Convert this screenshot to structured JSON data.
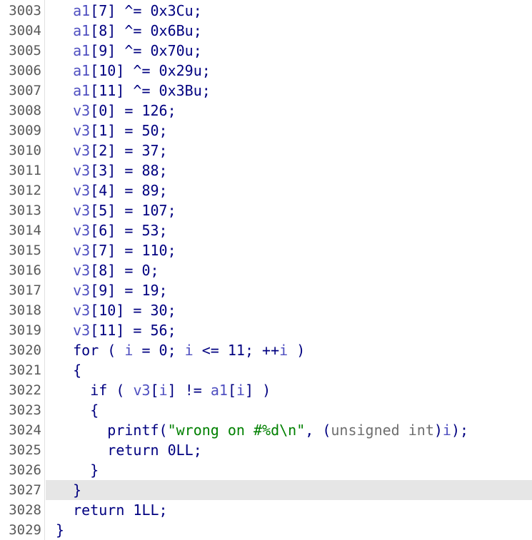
{
  "lines": [
    {
      "no": "3003",
      "indent": 1,
      "tokens": [
        {
          "t": "a1",
          "c": "v"
        },
        {
          "t": "[7] ^= 0x3Cu;",
          "c": "k"
        }
      ]
    },
    {
      "no": "3004",
      "indent": 1,
      "tokens": [
        {
          "t": "a1",
          "c": "v"
        },
        {
          "t": "[8] ^= 0x6Bu;",
          "c": "k"
        }
      ]
    },
    {
      "no": "3005",
      "indent": 1,
      "tokens": [
        {
          "t": "a1",
          "c": "v"
        },
        {
          "t": "[9] ^= 0x70u;",
          "c": "k"
        }
      ]
    },
    {
      "no": "3006",
      "indent": 1,
      "tokens": [
        {
          "t": "a1",
          "c": "v"
        },
        {
          "t": "[10] ^= 0x29u;",
          "c": "k"
        }
      ]
    },
    {
      "no": "3007",
      "indent": 1,
      "tokens": [
        {
          "t": "a1",
          "c": "v"
        },
        {
          "t": "[11] ^= 0x3Bu;",
          "c": "k"
        }
      ]
    },
    {
      "no": "3008",
      "indent": 1,
      "tokens": [
        {
          "t": "v3",
          "c": "v"
        },
        {
          "t": "[0] = 126;",
          "c": "k"
        }
      ]
    },
    {
      "no": "3009",
      "indent": 1,
      "tokens": [
        {
          "t": "v3",
          "c": "v"
        },
        {
          "t": "[1] = 50;",
          "c": "k"
        }
      ]
    },
    {
      "no": "3010",
      "indent": 1,
      "tokens": [
        {
          "t": "v3",
          "c": "v"
        },
        {
          "t": "[2] = 37;",
          "c": "k"
        }
      ]
    },
    {
      "no": "3011",
      "indent": 1,
      "tokens": [
        {
          "t": "v3",
          "c": "v"
        },
        {
          "t": "[3] = 88;",
          "c": "k"
        }
      ]
    },
    {
      "no": "3012",
      "indent": 1,
      "tokens": [
        {
          "t": "v3",
          "c": "v"
        },
        {
          "t": "[4] = 89;",
          "c": "k"
        }
      ]
    },
    {
      "no": "3013",
      "indent": 1,
      "tokens": [
        {
          "t": "v3",
          "c": "v"
        },
        {
          "t": "[5] = 107;",
          "c": "k"
        }
      ]
    },
    {
      "no": "3014",
      "indent": 1,
      "tokens": [
        {
          "t": "v3",
          "c": "v"
        },
        {
          "t": "[6] = 53;",
          "c": "k"
        }
      ]
    },
    {
      "no": "3015",
      "indent": 1,
      "tokens": [
        {
          "t": "v3",
          "c": "v"
        },
        {
          "t": "[7] = 110;",
          "c": "k"
        }
      ]
    },
    {
      "no": "3016",
      "indent": 1,
      "tokens": [
        {
          "t": "v3",
          "c": "v"
        },
        {
          "t": "[8] = 0;",
          "c": "k"
        }
      ]
    },
    {
      "no": "3017",
      "indent": 1,
      "tokens": [
        {
          "t": "v3",
          "c": "v"
        },
        {
          "t": "[9] = 19;",
          "c": "k"
        }
      ]
    },
    {
      "no": "3018",
      "indent": 1,
      "tokens": [
        {
          "t": "v3",
          "c": "v"
        },
        {
          "t": "[10] = 30;",
          "c": "k"
        }
      ]
    },
    {
      "no": "3019",
      "indent": 1,
      "tokens": [
        {
          "t": "v3",
          "c": "v"
        },
        {
          "t": "[11] = 56;",
          "c": "k"
        }
      ]
    },
    {
      "no": "3020",
      "indent": 1,
      "tokens": [
        {
          "t": "for ( ",
          "c": "k"
        },
        {
          "t": "i",
          "c": "v"
        },
        {
          "t": " = 0; ",
          "c": "k"
        },
        {
          "t": "i",
          "c": "v"
        },
        {
          "t": " <= 11; ++",
          "c": "k"
        },
        {
          "t": "i",
          "c": "v"
        },
        {
          "t": " )",
          "c": "k"
        }
      ]
    },
    {
      "no": "3021",
      "indent": 1,
      "tokens": [
        {
          "t": "{",
          "c": "k"
        }
      ]
    },
    {
      "no": "3022",
      "indent": 2,
      "tokens": [
        {
          "t": "if ( ",
          "c": "k"
        },
        {
          "t": "v3",
          "c": "v"
        },
        {
          "t": "[",
          "c": "k"
        },
        {
          "t": "i",
          "c": "v"
        },
        {
          "t": "] != ",
          "c": "k"
        },
        {
          "t": "a1",
          "c": "v"
        },
        {
          "t": "[",
          "c": "k"
        },
        {
          "t": "i",
          "c": "v"
        },
        {
          "t": "] )",
          "c": "k"
        }
      ]
    },
    {
      "no": "3023",
      "indent": 2,
      "tokens": [
        {
          "t": "{",
          "c": "k"
        }
      ]
    },
    {
      "no": "3024",
      "indent": 3,
      "tokens": [
        {
          "t": "printf(",
          "c": "k"
        },
        {
          "t": "\"wrong on #%d\\n\"",
          "c": "s"
        },
        {
          "t": ", (",
          "c": "k"
        },
        {
          "t": "unsigned int",
          "c": "t"
        },
        {
          "t": ")",
          "c": "k"
        },
        {
          "t": "i",
          "c": "v"
        },
        {
          "t": ");",
          "c": "k"
        }
      ]
    },
    {
      "no": "3025",
      "indent": 3,
      "tokens": [
        {
          "t": "return 0LL;",
          "c": "k"
        }
      ]
    },
    {
      "no": "3026",
      "indent": 2,
      "tokens": [
        {
          "t": "}",
          "c": "k"
        }
      ]
    },
    {
      "no": "3027",
      "indent": 1,
      "highlight": true,
      "tokens": [
        {
          "t": "}",
          "c": "k"
        }
      ]
    },
    {
      "no": "3028",
      "indent": 1,
      "tokens": [
        {
          "t": "return 1LL;",
          "c": "k"
        }
      ]
    },
    {
      "no": "3029",
      "indent": 0,
      "tokens": [
        {
          "t": "}",
          "c": "k"
        }
      ]
    }
  ],
  "colors": {
    "keyword": "#000080",
    "variable": "#4f4fc0",
    "string": "#008000",
    "type": "#6f6f6f",
    "line_number": "#5a5a5a",
    "current_line": "#e6e6e6"
  }
}
